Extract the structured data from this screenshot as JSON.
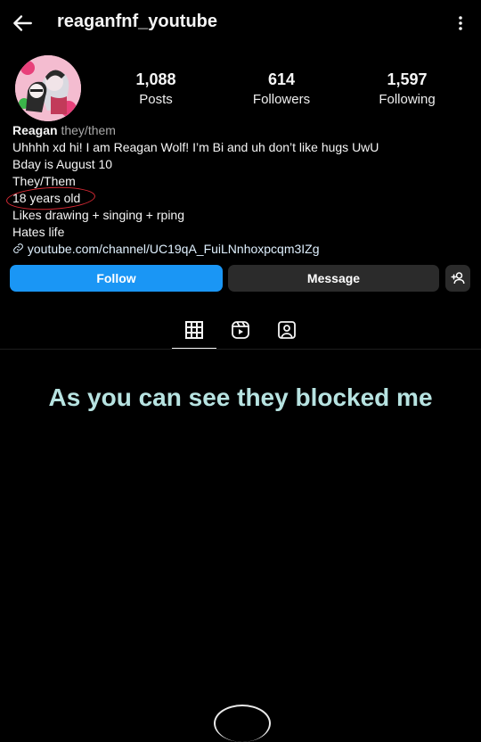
{
  "header": {
    "username": "reaganfnf_youtube",
    "back_icon": "arrow-left-icon",
    "more_icon": "more-vertical-icon"
  },
  "profile": {
    "avatar_icon": "avatar-illustration",
    "stats": [
      {
        "value": "1,088",
        "label": "Posts"
      },
      {
        "value": "614",
        "label": "Followers"
      },
      {
        "value": "1,597",
        "label": "Following"
      }
    ]
  },
  "bio": {
    "name": "Reagan",
    "pronouns": "they/them",
    "lines": [
      "Uhhhh xd hi! I am Reagan Wolf! I’m Bi and uh don’t like hugs UwU",
      "Bday is August 10",
      "They/Them",
      "18 years old",
      "Likes drawing + singing + rping",
      "Hates life"
    ],
    "link": "youtube.com/channel/UC19qA_FuiLNnhoxpcqm3IZg",
    "annotation_color": "#d72a35"
  },
  "actions": {
    "follow_label": "Follow",
    "message_label": "Message",
    "add_user_icon": "add-user-icon",
    "follow_color": "#1a96f5"
  },
  "tabs": [
    {
      "icon": "grid-icon",
      "active": true
    },
    {
      "icon": "reels-icon",
      "active": false
    },
    {
      "icon": "tagged-icon",
      "active": false
    }
  ],
  "caption": "As you can see they blocked me"
}
